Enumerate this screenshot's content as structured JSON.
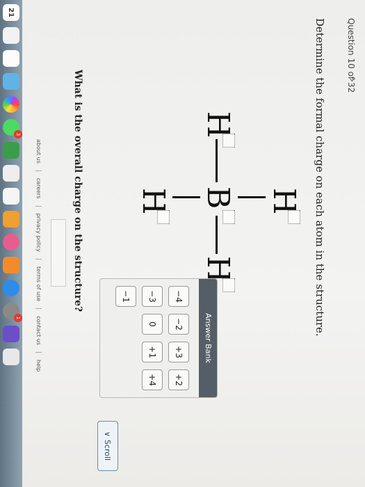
{
  "question": {
    "counter": "Question 10 of 32",
    "next_glyph": "›",
    "prompt": "Determine the formal charge on each atom in the structure.",
    "followup": "What is the overall charge on the structure?"
  },
  "molecule": {
    "atoms": {
      "top": "H",
      "left": "H",
      "center": "B",
      "right": "H",
      "bottom": "H"
    }
  },
  "answer_bank": {
    "title": "Answer Bank",
    "chips": [
      "−4",
      "−2",
      "+3",
      "+2",
      "−3",
      "0",
      "+1",
      "+4",
      "−1"
    ]
  },
  "scroll": {
    "label": "Scroll",
    "glyph": "∨"
  },
  "footer": {
    "links": [
      "about us",
      "careers",
      "privacy policy",
      "terms of use",
      "contact us",
      "help"
    ]
  },
  "dock": {
    "calendar_date": "21",
    "messages_badge": "3",
    "system_prefs_badge": "1"
  }
}
